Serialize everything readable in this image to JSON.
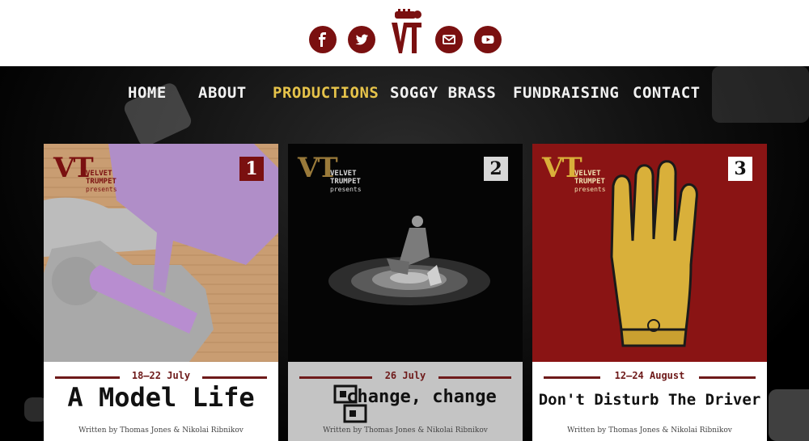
{
  "header": {
    "social": [
      {
        "name": "facebook",
        "glyph": "f"
      },
      {
        "name": "twitter",
        "glyph": "t"
      },
      {
        "name": "email",
        "glyph": "✉"
      },
      {
        "name": "youtube",
        "glyph": "▶"
      }
    ],
    "logo_text": "VT"
  },
  "nav": {
    "items": [
      "HOME",
      "ABOUT",
      "PRODUCTIONS",
      "SOGGY BRASS",
      "FUNDRAISING",
      "CONTACT"
    ],
    "active": "PRODUCTIONS"
  },
  "brand": {
    "vt": "VT",
    "line1": "VELVET",
    "line2": "TRUMPET",
    "line3": "presents"
  },
  "productions": [
    {
      "number": "1",
      "date": "18–22 July",
      "title": "A Model Life",
      "credit": "Written by Thomas Jones & Nikolai Ribnikov"
    },
    {
      "number": "2",
      "date": "26 July",
      "title": "change, change",
      "credit": "Written by Thomas Jones & Nikolai Ribnikov"
    },
    {
      "number": "3",
      "date": "12–24 August",
      "title": "Don't Disturb The Driver",
      "credit": "Written by Thomas Jones & Nikolai Ribnikov"
    }
  ],
  "colors": {
    "brand_red": "#7a1010",
    "nav_active": "#e6c34a",
    "poster3_bg": "#8a1414",
    "glove": "#d9b03a"
  }
}
